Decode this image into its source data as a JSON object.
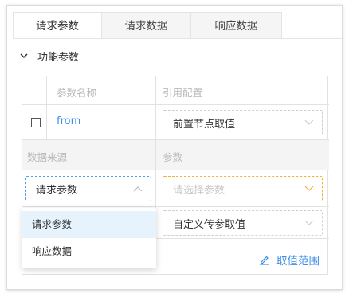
{
  "tabs": [
    {
      "label": "请求参数",
      "active": true
    },
    {
      "label": "请求数据",
      "active": false
    },
    {
      "label": "响应数据",
      "active": false
    }
  ],
  "section": {
    "title": "功能参数",
    "icon": "chevron-down-icon"
  },
  "table": {
    "header": {
      "param_name": "参数名称",
      "ref_config": "引用配置"
    },
    "row": {
      "name": "from",
      "ref_value": "前置节点取值"
    },
    "sub_header": {
      "data_source": "数据来源",
      "param": "参数"
    },
    "data_source_select": {
      "value": "请求参数"
    },
    "param_select": {
      "placeholder": "请选择参数"
    },
    "custom_select": {
      "value": "自定义传参取值"
    }
  },
  "dropdown": {
    "options": [
      {
        "label": "请求参数",
        "selected": true
      },
      {
        "label": "响应数据",
        "selected": false
      }
    ]
  },
  "range_button": {
    "label": "取值范围",
    "icon": "edit-icon"
  },
  "colors": {
    "accent": "#3d8ee6",
    "focus_border": "#4b9ef2",
    "warn_border": "#f1b13a",
    "selected_bg": "#e6f2fc"
  }
}
